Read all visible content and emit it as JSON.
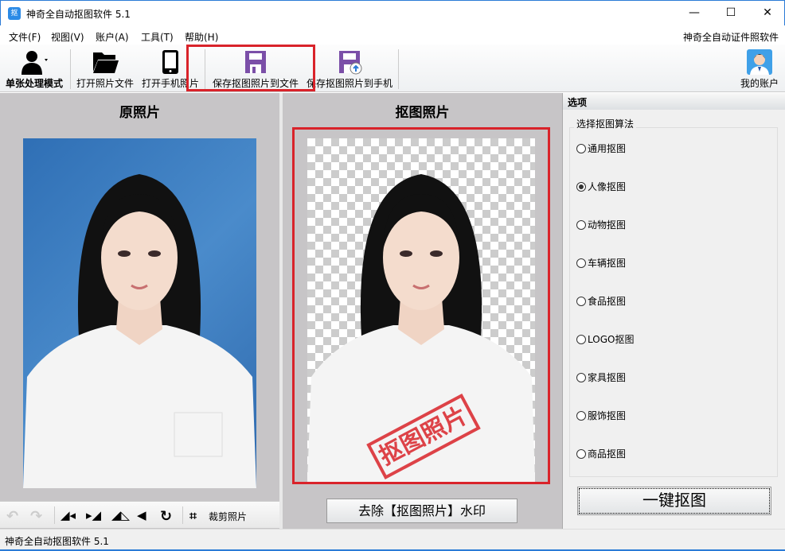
{
  "window": {
    "title": "神奇全自动抠图软件 5.1",
    "icon_text": "抠",
    "minimize": "—",
    "maximize": "☐",
    "close": "✕"
  },
  "menu": {
    "items": [
      "文件(F)",
      "视图(V)",
      "账户(A)",
      "工具(T)",
      "帮助(H)"
    ],
    "right_link": "神奇全自动证件照软件"
  },
  "toolbar": {
    "mode": "单张处理模式",
    "open_file": "打开照片文件",
    "open_phone": "打开手机照片",
    "save_file": "保存抠图照片到文件",
    "save_phone": "保存抠图照片到手机",
    "account": "我的账户"
  },
  "left": {
    "title": "原照片",
    "crop_label": "裁剪照片"
  },
  "middle": {
    "title": "抠图照片",
    "watermark": "抠图照片",
    "remove_watermark": "去除【抠图照片】水印"
  },
  "right": {
    "header": "选项",
    "group": "选择抠图算法",
    "options": [
      "通用抠图",
      "人像抠图",
      "动物抠图",
      "车辆抠图",
      "食品抠图",
      "LOGO抠图",
      "家具抠图",
      "服饰抠图",
      "商品抠图"
    ],
    "selected": "人像抠图",
    "action": "一键抠图"
  },
  "status": {
    "text": "神奇全自动抠图软件 5.1"
  },
  "colors": {
    "accent": "#2b7bd6",
    "highlight": "#d9232a",
    "save_purple": "#7b4fa8",
    "photo_bg": "#3f7fc0"
  }
}
